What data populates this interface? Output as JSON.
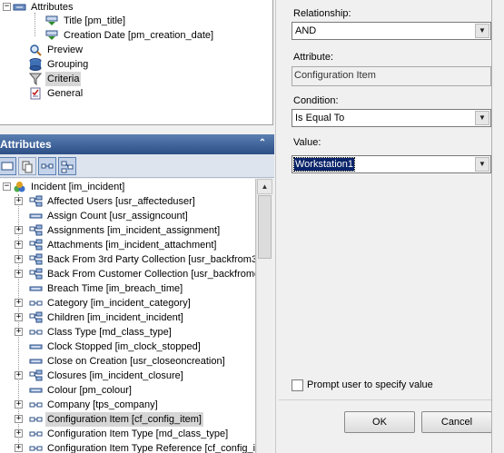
{
  "top_tree": {
    "attributes_node": "Attributes",
    "children": [
      {
        "label": "Title [pm_title]"
      },
      {
        "label": "Creation Date [pm_creation_date]"
      }
    ],
    "sections": [
      {
        "label": "Preview",
        "icon": "magnifier-icon"
      },
      {
        "label": "Grouping",
        "icon": "database-icon"
      },
      {
        "label": "Criteria",
        "icon": "funnel-icon",
        "selected": true
      },
      {
        "label": "General",
        "icon": "checklist-icon"
      }
    ]
  },
  "attributes_panel": {
    "title": "Attributes",
    "collapse_glyph": "⌃",
    "root": "Incident [im_incident]",
    "items": [
      {
        "label": "Affected Users [usr_affecteduser]",
        "expandable": true,
        "icon": "relation-icon"
      },
      {
        "label": "Assign Count [usr_assigncount]",
        "expandable": false,
        "icon": "field-icon"
      },
      {
        "label": "Assignments [im_incident_assignment]",
        "expandable": true,
        "icon": "relation-icon"
      },
      {
        "label": "Attachments [im_incident_attachment]",
        "expandable": true,
        "icon": "relation-icon"
      },
      {
        "label": "Back From 3rd Party Collection [usr_backfrom3rd",
        "expandable": true,
        "icon": "relation-icon"
      },
      {
        "label": "Back From Customer Collection [usr_backfromcu",
        "expandable": true,
        "icon": "relation-icon"
      },
      {
        "label": "Breach Time [im_breach_time]",
        "expandable": false,
        "icon": "field-icon"
      },
      {
        "label": "Category [im_incident_category]",
        "expandable": true,
        "icon": "link-icon"
      },
      {
        "label": "Children [im_incident_incident]",
        "expandable": true,
        "icon": "relation-icon"
      },
      {
        "label": "Class Type [md_class_type]",
        "expandable": true,
        "icon": "link-icon"
      },
      {
        "label": "Clock Stopped [im_clock_stopped]",
        "expandable": false,
        "icon": "field-icon"
      },
      {
        "label": "Close on Creation [usr_closeoncreation]",
        "expandable": false,
        "icon": "field-icon"
      },
      {
        "label": "Closures [im_incident_closure]",
        "expandable": true,
        "icon": "relation-icon"
      },
      {
        "label": "Colour [pm_colour]",
        "expandable": false,
        "icon": "field-icon"
      },
      {
        "label": "Company [tps_company]",
        "expandable": true,
        "icon": "link-icon"
      },
      {
        "label": "Configuration Item [cf_config_item]",
        "expandable": true,
        "icon": "link-icon",
        "selected": true
      },
      {
        "label": "Configuration Item Type [md_class_type]",
        "expandable": true,
        "icon": "link-icon"
      },
      {
        "label": "Configuration Item Type Reference [cf_config_i",
        "expandable": true,
        "icon": "link-icon"
      }
    ]
  },
  "criteria_form": {
    "relationship_label": "Relationship:",
    "relationship_value": "AND",
    "attribute_label": "Attribute:",
    "attribute_value": "Configuration Item",
    "condition_label": "Condition:",
    "condition_value": "Is Equal To",
    "value_label": "Value:",
    "value_value": "Workstation1",
    "prompt_label": "Prompt user to specify value",
    "prompt_checked": false,
    "ok_label": "OK",
    "cancel_label": "Cancel",
    "dropdown_glyph": "▼"
  },
  "colors": {
    "header_top": "#5a7fb2",
    "header_bottom": "#2c4f86",
    "selection_highlight": "#0a246a"
  }
}
